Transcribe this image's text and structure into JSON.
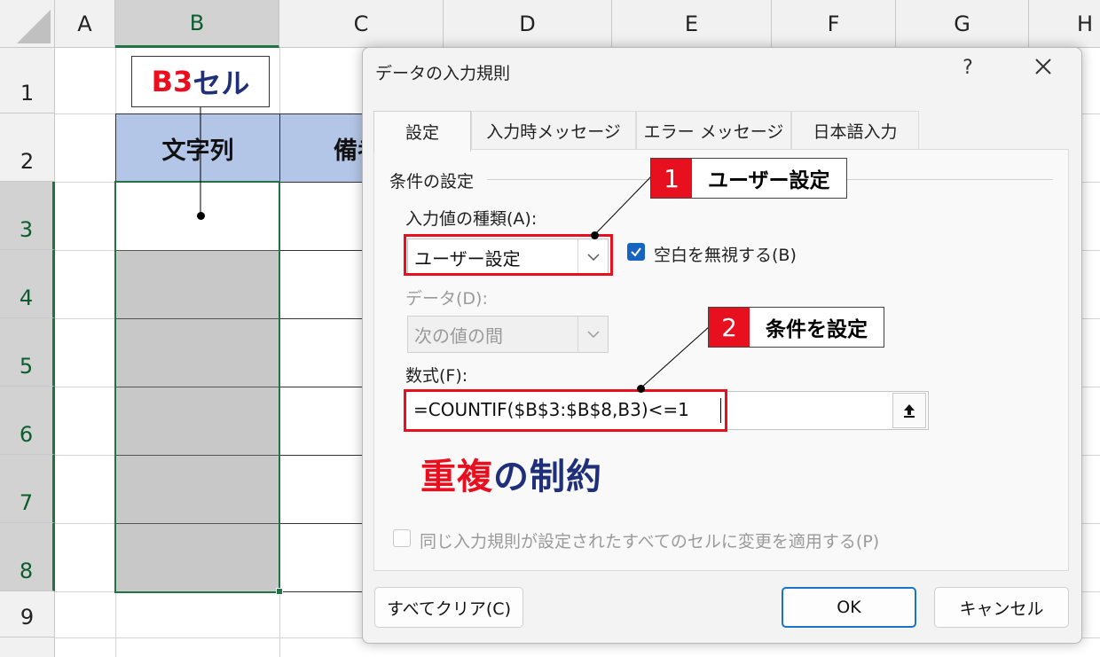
{
  "sheet": {
    "columns": [
      "A",
      "B",
      "C",
      "D",
      "E",
      "F",
      "G",
      "H"
    ],
    "rows": [
      "1",
      "2",
      "3",
      "4",
      "5",
      "6",
      "7",
      "8",
      "9"
    ],
    "header_cells": {
      "b2": "文字列",
      "c2": "備考"
    },
    "selection_range": "B3:B8"
  },
  "annotations": {
    "cell_callout": {
      "red": "B3",
      "navy": "セル"
    },
    "step1": {
      "number": "1",
      "text": "ユーザー設定"
    },
    "step2": {
      "number": "2",
      "text": "条件を設定"
    },
    "caption": {
      "red": "重複",
      "navy": "の制約"
    }
  },
  "dialog": {
    "title": "データの入力規則",
    "help": "?",
    "close_icon": "close-icon",
    "tabs": [
      "設定",
      "入力時メッセージ",
      "エラー メッセージ",
      "日本語入力"
    ],
    "active_tab": 0,
    "group_label": "条件の設定",
    "allow_label": "入力値の種類(A):",
    "allow_value": "ユーザー設定",
    "ignore_blank_label": "空白を無視する(B)",
    "ignore_blank_checked": true,
    "data_label": "データ(D):",
    "data_value": "次の値の間",
    "data_disabled": true,
    "formula_label": "数式(F):",
    "formula_value": "=COUNTIF($B$3:$B$8,B3)<=1",
    "apply_all_label": "同じ入力規則が設定されたすべてのセルに変更を適用する(P)",
    "apply_all_checked": false,
    "clear_button": "すべてクリア(C)",
    "ok_button": "OK",
    "cancel_button": "キャンセル"
  },
  "colors": {
    "accent_green": "#217346",
    "annotation_red": "#e8101e",
    "annotation_navy": "#1f2f7a",
    "header_fill": "#b4c6e7",
    "checkbox_blue": "#1565c0"
  }
}
